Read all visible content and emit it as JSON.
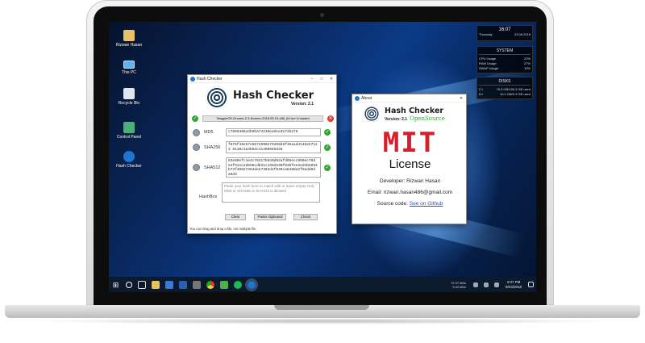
{
  "desktop": {
    "icons": [
      {
        "label": "Rizwan Hasan",
        "icon": "folder-user-icon"
      },
      {
        "label": "This PC",
        "icon": "computer-icon"
      },
      {
        "label": "Recycle Bin",
        "icon": "recycle-bin-icon"
      },
      {
        "label": "Control Panel",
        "icon": "control-panel-icon"
      },
      {
        "label": "Hash Checker",
        "icon": "hash-checker-icon"
      }
    ]
  },
  "clock_widget": {
    "time": "16:07",
    "day": "Thursday",
    "date": "23.08.2018"
  },
  "system_widget": {
    "title": "SYSTEM",
    "rows": [
      {
        "label": "CPU Usage",
        "value": "22%"
      },
      {
        "label": "RAM Usage",
        "value": "27%"
      },
      {
        "label": "SWAP Usage",
        "value": "19%"
      }
    ]
  },
  "disks_widget": {
    "title": "DISKS",
    "rows": [
      {
        "label": "C:\\",
        "value": "75.5 GB/156.3 GB used"
      },
      {
        "label": "D:\\",
        "value": "10.1 GB/0.3 GB used"
      }
    ]
  },
  "hash_window": {
    "title": "Hash Checker",
    "brand": "Hash Checker",
    "version": "Version: 2.1",
    "loaded_text": "'MagpieOS-Gnome-2.3-Noreen-2018.05.15-x86_64.iso' is loaded",
    "md5": {
      "label": "MD5",
      "value": "c7869468a4b9ba74236ea91e3172b276"
    },
    "sha256": {
      "label": "SHA256",
      "value": "f675f49e57e5074590279206b5f35aad4148227123 8110c3a4b8dc41308665d49"
    },
    "sha512": {
      "label": "SHA512",
      "value": "63e60efc1e4c76217b840d92afd05ecc900ec70d e4f911c2d556cdb21c1392530f03bfee3ed4b5894 b73f40627364dee7392d2f039ca8488a2f9add0d a6d3"
    },
    "hashbox": {
      "label": "HashBox",
      "placeholder": "Paste your hash here to match with or leave empty Only MD5 or SHA256 or SHA512 is allowed"
    },
    "buttons": {
      "clear": "Clear",
      "paste": "Paste clipboard",
      "check": "Check"
    },
    "status": "You can drag and drop a file, not multiple file"
  },
  "about_window": {
    "title": "About",
    "brand": "Hash Checker",
    "version": "Version: 2.1",
    "opensource": "OpenSource",
    "mit": "MIT",
    "license": "License",
    "developer": "Developer: Rizwan Hasan",
    "email": "Email: rizwan.hasan486@gmail.com",
    "source_label": "Source code:",
    "source_link": "See on Github"
  },
  "taskbar": {
    "tray_up": "72.97 kB/s",
    "tray_down": "9.02 kB/s",
    "time": "4:07 PM",
    "date": "8/23/2018"
  },
  "colors": {
    "accent_green": "#2ea82e",
    "accent_red": "#e03b2e",
    "mit_red": "#d9202a",
    "link_blue": "#1a56d6"
  }
}
